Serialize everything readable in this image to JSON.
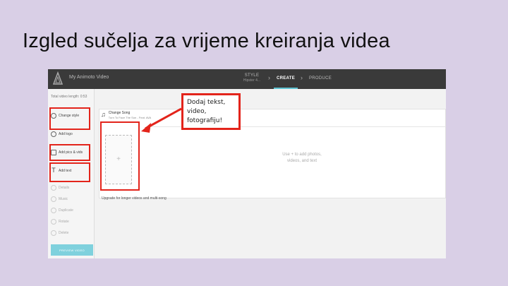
{
  "slide": {
    "title": "Izgled sučelja za vrijeme kreiranja videa"
  },
  "app": {
    "title": "My Animoto Video",
    "logo_icon": "animoto-logo-icon",
    "steps": [
      {
        "name": "STYLE",
        "sub": "Hipster 4...",
        "active": false
      },
      {
        "name": "CREATE",
        "sub": "",
        "active": true
      },
      {
        "name": "PRODUCE",
        "sub": "",
        "active": false
      }
    ]
  },
  "sidebar": {
    "video_length": "Total video length: 0:53",
    "items": [
      {
        "label": "Change style",
        "icon": "palette-icon"
      },
      {
        "label": "Add logo",
        "icon": "logo-icon"
      },
      {
        "label": "Add pics & vids",
        "icon": "image-icon"
      },
      {
        "label": "Add text",
        "icon": "text-icon"
      },
      {
        "label": "Details",
        "icon": "dots-icon"
      },
      {
        "label": "Music",
        "icon": "music-icon"
      },
      {
        "label": "Duplicate",
        "icon": "copy-icon"
      },
      {
        "label": "Rotate",
        "icon": "rotate-icon"
      },
      {
        "label": "Delete",
        "icon": "trash-icon"
      }
    ],
    "preview_button": "PREVIEW VIDEO"
  },
  "song": {
    "title": "Change Song",
    "subtitle": "Turn To Face The Sun - Feat. AVA"
  },
  "main": {
    "add_slot_symbol": "+",
    "hint": "Use + to add photos, videos, and text",
    "upgrade": "Upgrade for longer videos and multi-song"
  },
  "callout": {
    "text": "Dodaj tekst, video, fotografiju!"
  },
  "colors": {
    "accent": "#5ec3d2",
    "highlight": "#e3241b",
    "background": "#d9cfe6"
  }
}
